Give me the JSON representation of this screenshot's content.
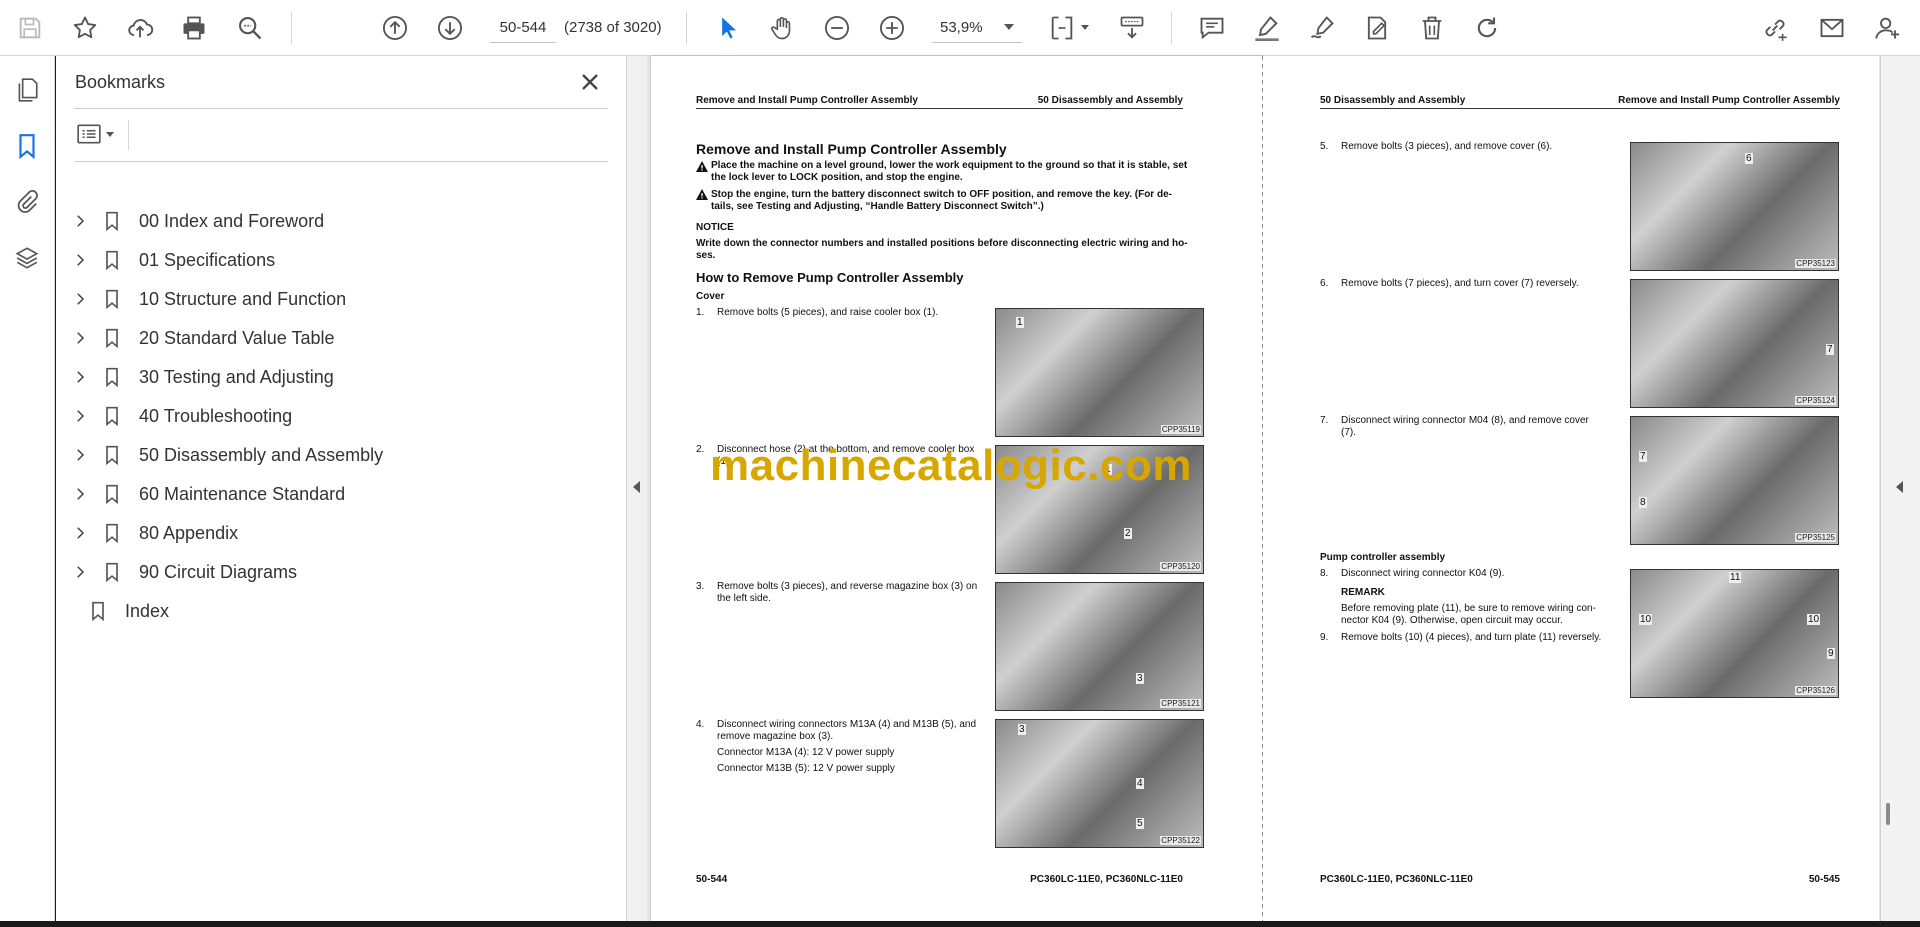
{
  "toolbar": {
    "page_value": "50-544",
    "page_count": "(2738 of 3020)",
    "zoom": "53,9%"
  },
  "bookmarks": {
    "title": "Bookmarks",
    "items": [
      {
        "label": "00 Index and Foreword",
        "expandable": true
      },
      {
        "label": "01 Specifications",
        "expandable": true
      },
      {
        "label": "10 Structure and Function",
        "expandable": true
      },
      {
        "label": "20 Standard Value Table",
        "expandable": true
      },
      {
        "label": "30 Testing and Adjusting",
        "expandable": true
      },
      {
        "label": "40 Troubleshooting",
        "expandable": true
      },
      {
        "label": "50 Disassembly and Assembly",
        "expandable": true
      },
      {
        "label": "60 Maintenance Standard",
        "expandable": true
      },
      {
        "label": "80 Appendix",
        "expandable": true
      },
      {
        "label": "90 Circuit Diagrams",
        "expandable": true
      },
      {
        "label": "Index",
        "expandable": false
      }
    ]
  },
  "left_page": {
    "header_left": "Remove and Install Pump Controller Assembly",
    "header_right": "50 Disassembly and Assembly",
    "title": "Remove and Install Pump Controller Assembly",
    "warn1_line1": "Place the machine on a level ground, lower the work equipment to the ground so that it is stable, set",
    "warn1_line2": "the lock lever to LOCK position, and stop the engine.",
    "warn2_line1": "Stop the engine, turn the battery disconnect switch to OFF position, and remove the key. (For de-",
    "warn2_line2": "tails, see Testing and Adjusting, “Handle Battery Disconnect Switch”.)",
    "notice_label": "NOTICE",
    "notice_line1": "Write down the connector numbers and installed positions before disconnecting electric wiring and ho-",
    "notice_line2": "ses.",
    "subtitle": "How to Remove Pump Controller Assembly",
    "cover_label": "Cover",
    "steps": [
      {
        "num": "1.",
        "line1": "Remove bolts (5 pieces), and raise cooler box (1).",
        "line2": ""
      },
      {
        "num": "2.",
        "line1": "Disconnect hose (2) at the bottom, and remove cooler box",
        "line2": "(1)."
      },
      {
        "num": "3.",
        "line1": "Remove bolts (3 pieces), and reverse magazine box (3) on",
        "line2": "the left side."
      },
      {
        "num": "4.",
        "line1": "Disconnect wiring connectors M13A (4) and M13B (5), and",
        "line2": "remove magazine box (3)."
      }
    ],
    "step4_extra1": "Connector M13A (4): 12 V power supply",
    "step4_extra2": "Connector M13B (5): 12 V power supply",
    "photos": [
      {
        "code": "CPP35119",
        "callouts": [
          "1"
        ]
      },
      {
        "code": "CPP35120",
        "callouts": [
          "1",
          "2"
        ]
      },
      {
        "code": "CPP35121",
        "callouts": [
          "3"
        ]
      },
      {
        "code": "CPP35122",
        "callouts": [
          "3",
          "4",
          "5"
        ]
      }
    ],
    "footer_left": "50-544",
    "footer_right": "PC360LC-11E0, PC360NLC-11E0"
  },
  "right_page": {
    "header_left": "50 Disassembly and Assembly",
    "header_right": "Remove and Install Pump Controller Assembly",
    "steps": [
      {
        "num": "5.",
        "line1": "Remove bolts (3 pieces), and remove cover (6).",
        "line2": ""
      },
      {
        "num": "6.",
        "line1": "Remove bolts (7 pieces), and turn cover (7) reversely.",
        "line2": ""
      },
      {
        "num": "7.",
        "line1": "Disconnect wiring connector M04 (8), and remove cover",
        "line2": "(7)."
      }
    ],
    "section_label": "Pump controller assembly",
    "step8": {
      "num": "8.",
      "text": "Disconnect wiring connector K04 (9)."
    },
    "remark_label": "REMARK",
    "remark_line1": "Before removing plate (11), be sure to remove wiring con-",
    "remark_line2": "nector K04 (9). Otherwise, open circuit may occur.",
    "step9": {
      "num": "9.",
      "text": "Remove bolts (10) (4 pieces), and turn plate (11) reversely."
    },
    "photos": [
      {
        "code": "CPP35123",
        "callouts": [
          "6"
        ]
      },
      {
        "code": "CPP35124",
        "callouts": [
          "7"
        ]
      },
      {
        "code": "CPP35125",
        "callouts": [
          "7",
          "8"
        ]
      },
      {
        "code": "CPP35126",
        "callouts": [
          "11",
          "10",
          "10",
          "9"
        ]
      }
    ],
    "footer_left": "PC360LC-11E0, PC360NLC-11E0",
    "footer_right": "50-545"
  },
  "watermark": "machinecatalogic.com"
}
